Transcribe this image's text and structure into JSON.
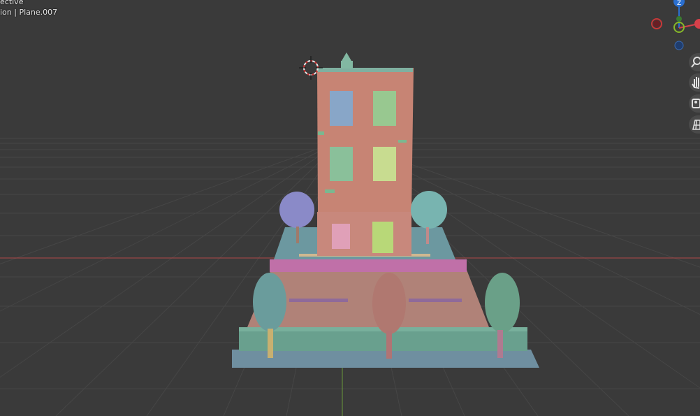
{
  "viewport": {
    "view_mode": "ective",
    "info_line": "ion | Plane.007"
  },
  "colors": {
    "background": "#3a3a3a",
    "grid": "#464646",
    "x_axis": "#b04848",
    "y_axis": "#6a9a3a",
    "building_wall": "#c78474",
    "ground_base": "#6f8fa0",
    "path_deck": "#b08278"
  },
  "gizmo": {
    "axes": [
      {
        "name": "Z",
        "color": "#2a6fd0"
      },
      {
        "name": "Y",
        "color": "#86b82a"
      },
      {
        "name": "X",
        "color": "#d6404a"
      },
      {
        "name": "-X",
        "color": "#8a2a30"
      },
      {
        "name": "-Y",
        "color": "#3a7a30"
      },
      {
        "name": "-Z",
        "color": "#203f70"
      }
    ],
    "z_label": "Z"
  },
  "nav_tools": [
    {
      "name": "zoom",
      "icon": "magnifier-icon"
    },
    {
      "name": "pan",
      "icon": "hand-icon"
    },
    {
      "name": "camera",
      "icon": "camera-icon"
    },
    {
      "name": "perspective-toggle",
      "icon": "grid-icon"
    }
  ]
}
